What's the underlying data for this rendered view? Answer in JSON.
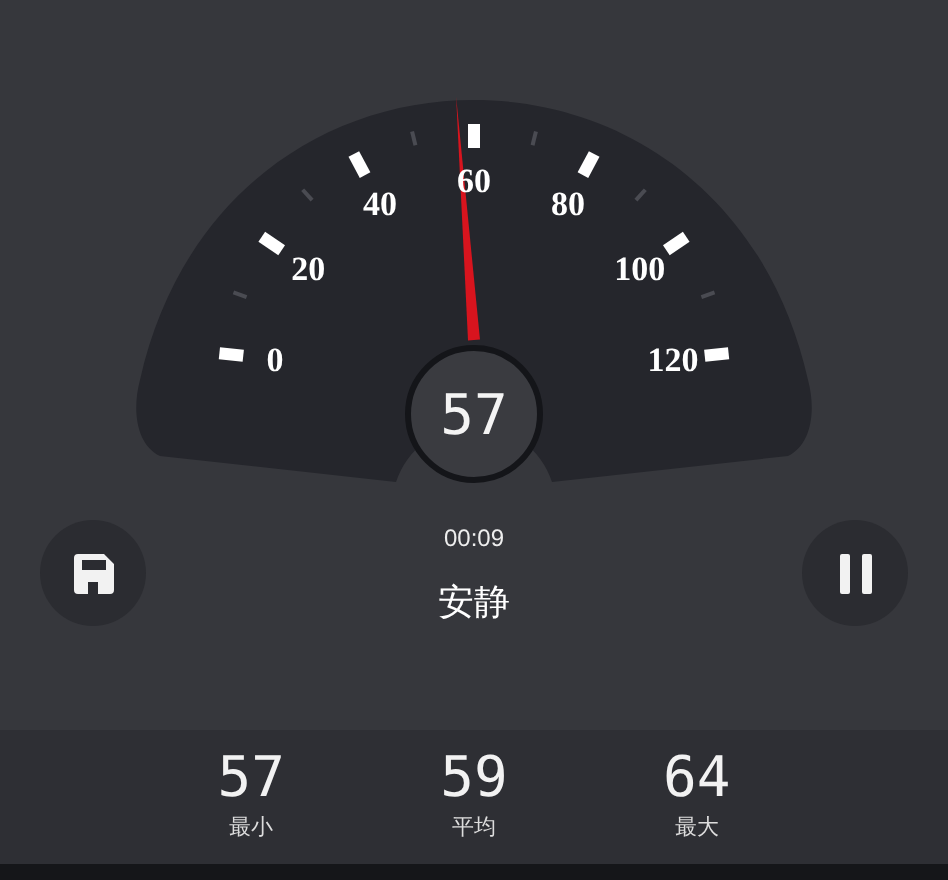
{
  "gauge": {
    "tick_labels": [
      "0",
      "20",
      "40",
      "60",
      "80",
      "100",
      "120"
    ],
    "reading": "57"
  },
  "elapsed": "00:09",
  "status": "安静",
  "stats": [
    {
      "value": "57",
      "label": "最小"
    },
    {
      "value": "59",
      "label": "平均"
    },
    {
      "value": "64",
      "label": "最大"
    }
  ]
}
